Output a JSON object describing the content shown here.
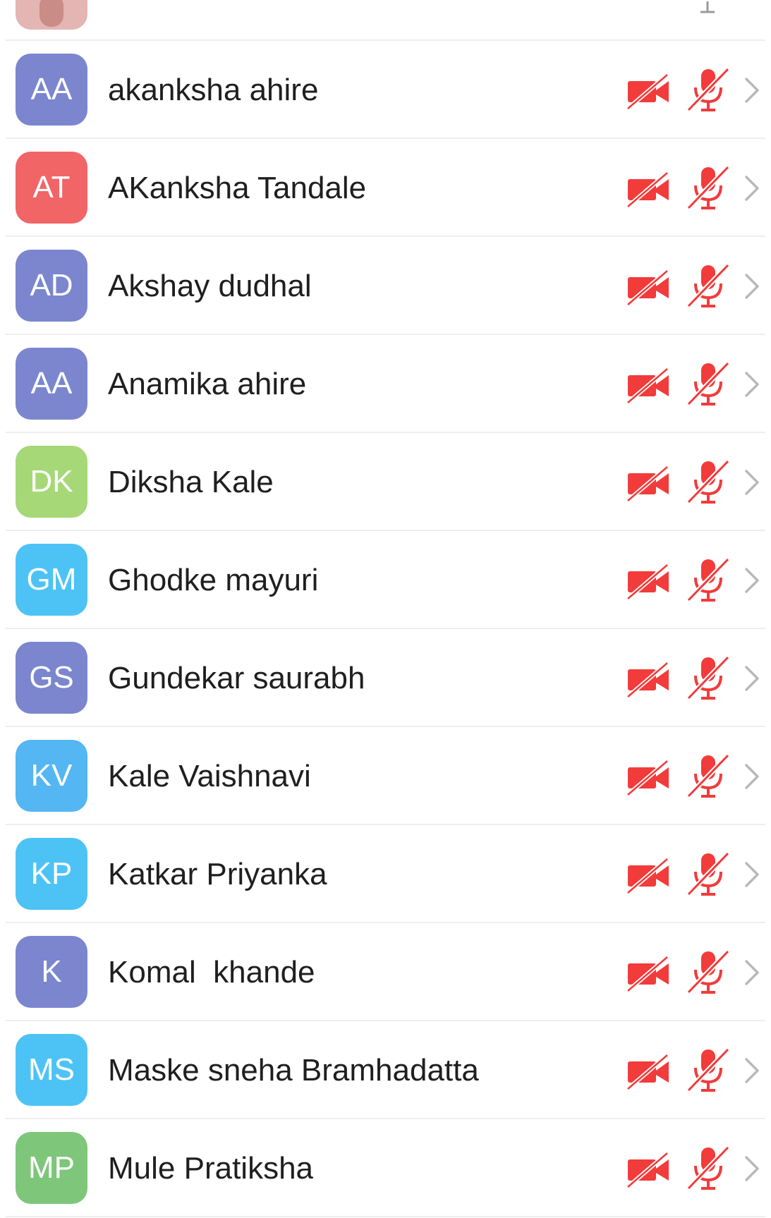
{
  "participants": [
    {
      "initials": "AA",
      "name": "akanksha ahire",
      "avatar_color": "#7b86cf"
    },
    {
      "initials": "AT",
      "name": "AKanksha Tandale",
      "avatar_color": "#f16567"
    },
    {
      "initials": "AD",
      "name": "Akshay dudhal",
      "avatar_color": "#7b86cf"
    },
    {
      "initials": "AA",
      "name": "Anamika ahire",
      "avatar_color": "#7b86cf"
    },
    {
      "initials": "DK",
      "name": "Diksha Kale",
      "avatar_color": "#a6d878"
    },
    {
      "initials": "GM",
      "name": "Ghodke mayuri",
      "avatar_color": "#4dc3f5"
    },
    {
      "initials": "GS",
      "name": "Gundekar saurabh",
      "avatar_color": "#7b86cf"
    },
    {
      "initials": "KV",
      "name": "Kale Vaishnavi",
      "avatar_color": "#54b6f2"
    },
    {
      "initials": "KP",
      "name": "Katkar Priyanka",
      "avatar_color": "#4dc3f5"
    },
    {
      "initials": "K",
      "name": "Komal  khande",
      "avatar_color": "#7b86cf"
    },
    {
      "initials": "MS",
      "name": "Maske sneha Bramhadatta",
      "avatar_color": "#4dc3f5"
    },
    {
      "initials": "MP",
      "name": "Mule Pratiksha",
      "avatar_color": "#7dc67a"
    }
  ],
  "icons": {
    "video": "video-off-icon",
    "audio": "mic-muted-icon",
    "detail": "chevron-right-icon"
  },
  "colors": {
    "muted_red": "#f23b3b",
    "chevron": "#b9b9b9",
    "divider": "#eeeeee",
    "name_text": "#1f1f1f"
  }
}
